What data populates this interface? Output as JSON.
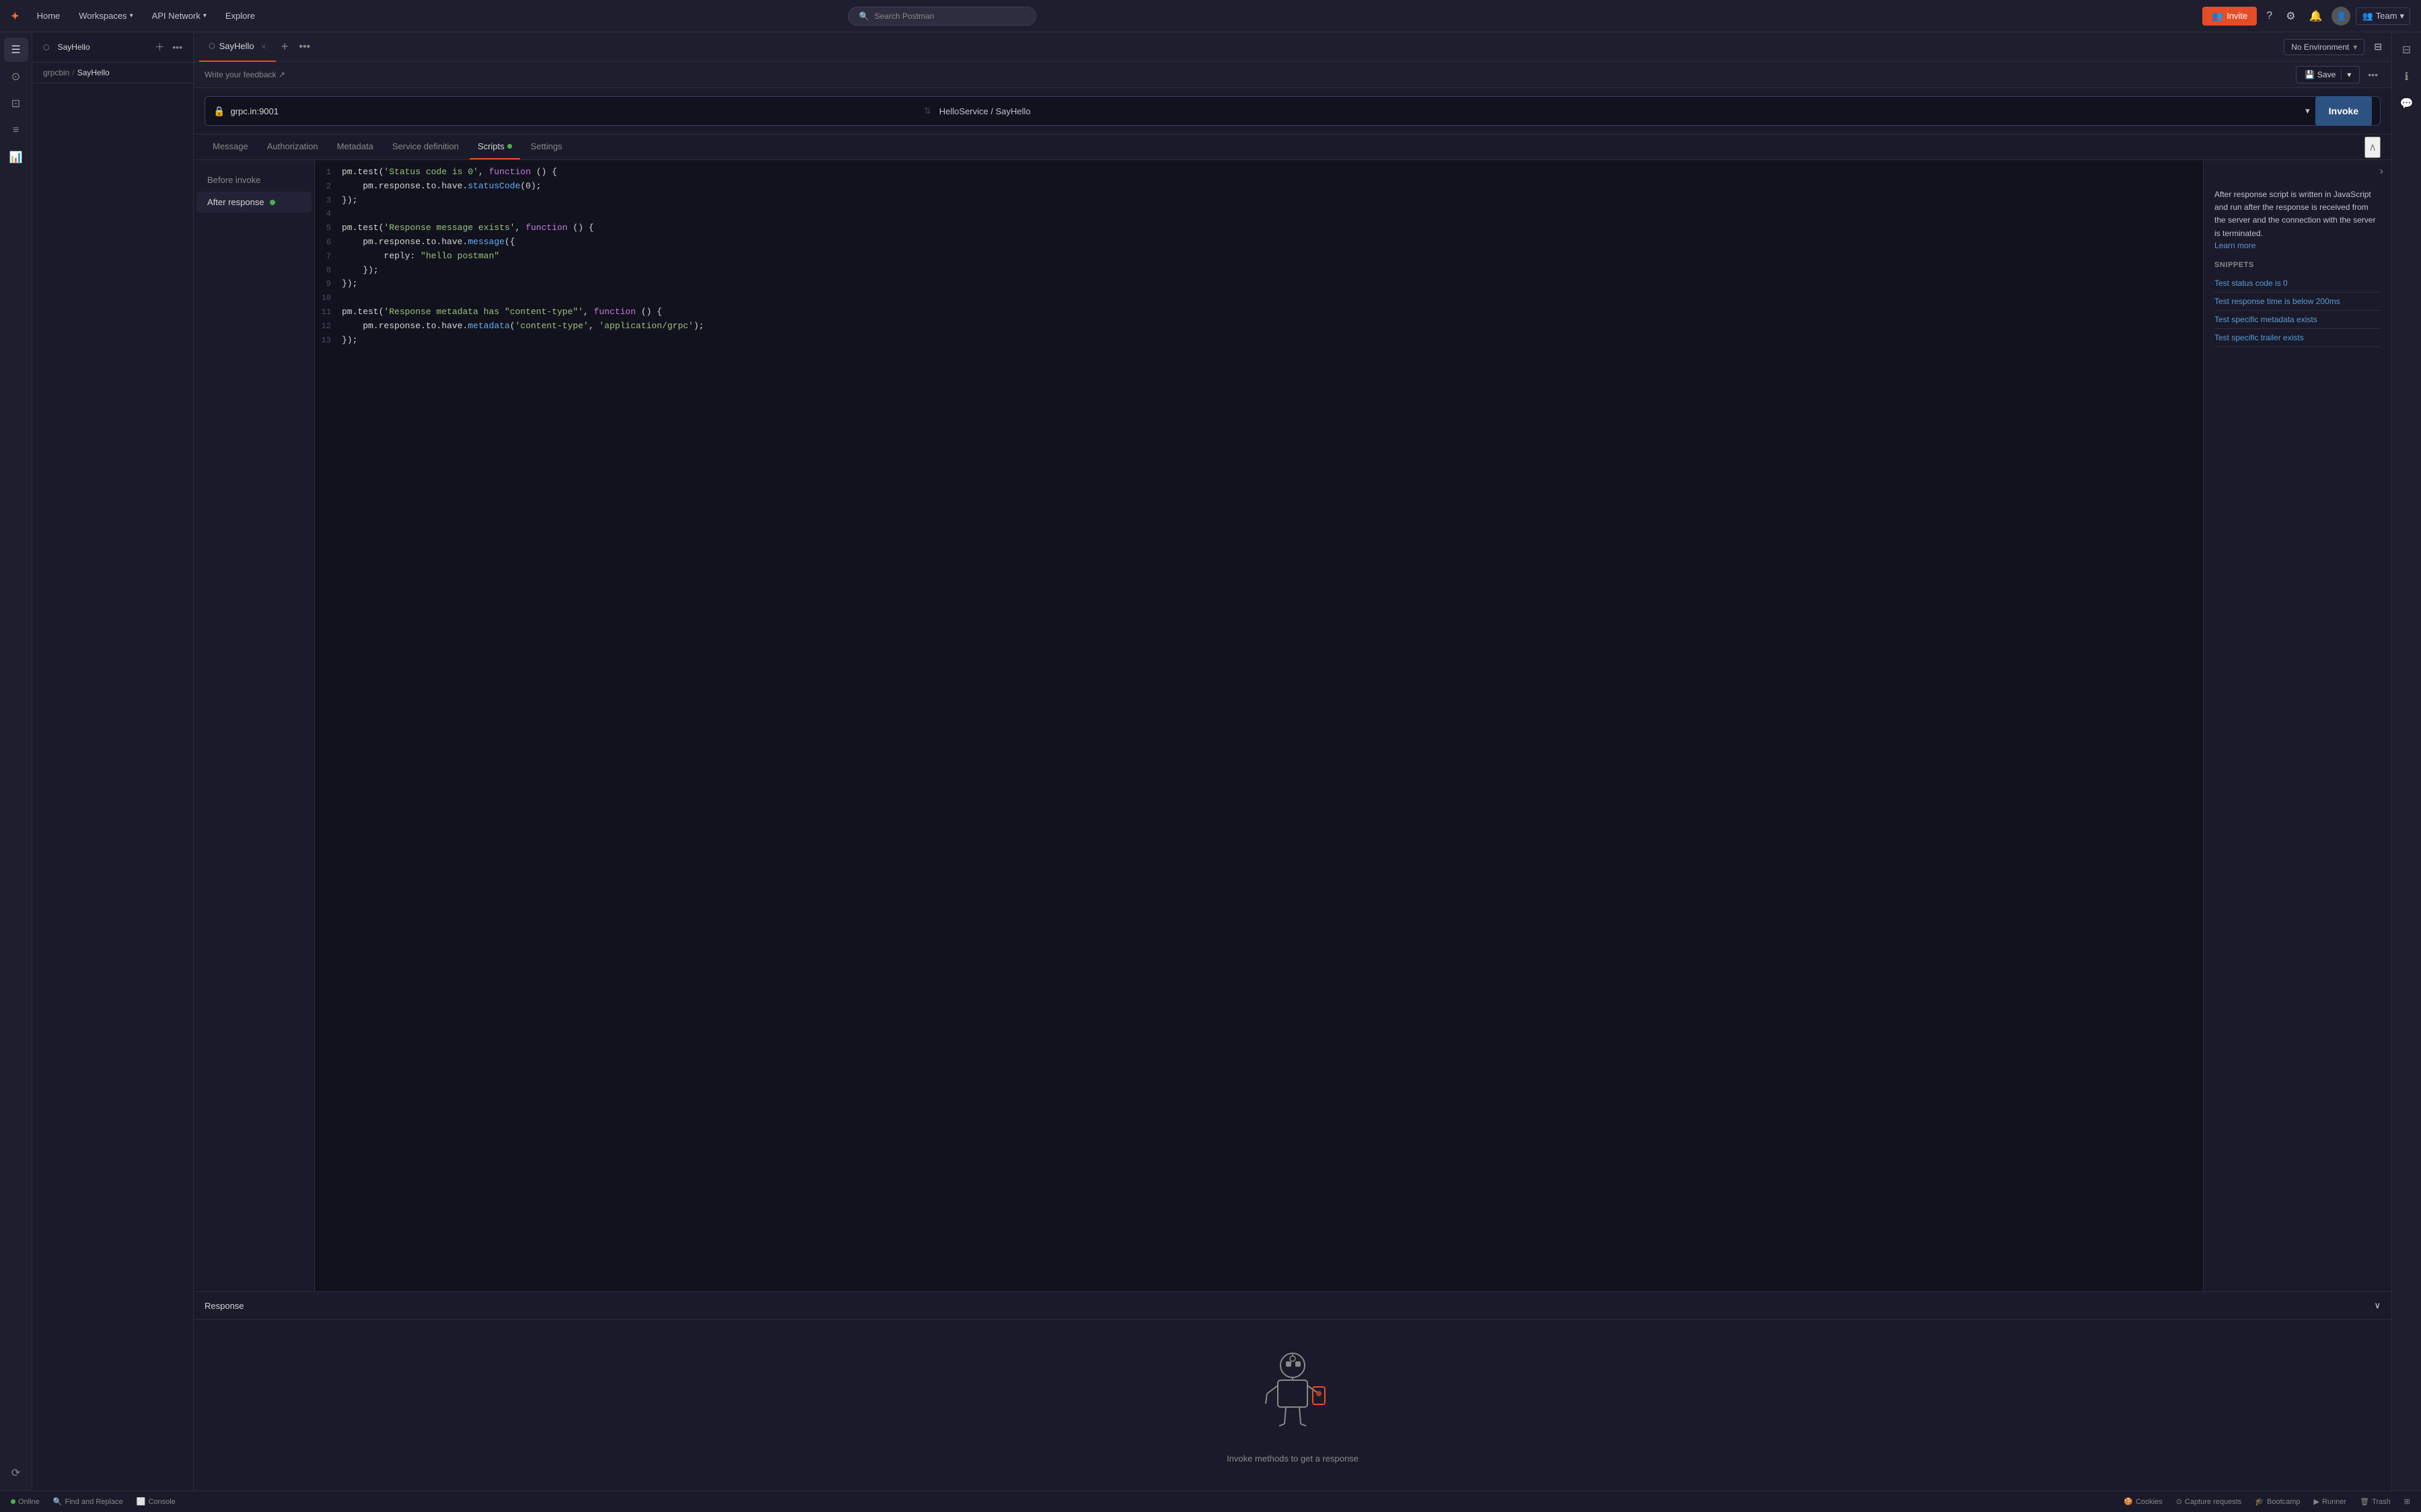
{
  "nav": {
    "home": "Home",
    "workspaces": "Workspaces",
    "api_network": "API Network",
    "explore": "Explore",
    "search_placeholder": "Search Postman",
    "invite_label": "Invite",
    "team_label": "Team"
  },
  "tabs_bar": {
    "active_tab": "SayHello",
    "tab_icon": "⬡"
  },
  "env": {
    "label": "No Environment"
  },
  "breadcrumb": {
    "parent": "grpcbin",
    "separator": "/",
    "current": "SayHello"
  },
  "request": {
    "url": "grpc.in:9001",
    "service_path": "HelloService / SayHello",
    "invoke_label": "Invoke"
  },
  "request_tabs": {
    "message": "Message",
    "authorization": "Authorization",
    "metadata": "Metadata",
    "service_definition": "Service definition",
    "scripts": "Scripts",
    "settings": "Settings"
  },
  "scripts_sidebar": {
    "before_invoke": "Before invoke",
    "after_response": "After response"
  },
  "code_lines": [
    {
      "num": 1,
      "parts": [
        {
          "text": "pm",
          "cls": "c-default"
        },
        {
          "text": ".test(",
          "cls": "c-default"
        },
        {
          "text": "'Status code is 0'",
          "cls": "c-green"
        },
        {
          "text": ", ",
          "cls": "c-default"
        },
        {
          "text": "function",
          "cls": "c-purple"
        },
        {
          "text": " () {",
          "cls": "c-default"
        }
      ]
    },
    {
      "num": 2,
      "parts": [
        {
          "text": "    pm",
          "cls": "c-default"
        },
        {
          "text": ".response.to.have.",
          "cls": "c-default"
        },
        {
          "text": "statusCode",
          "cls": "c-blue"
        },
        {
          "text": "(0);",
          "cls": "c-default"
        }
      ]
    },
    {
      "num": 3,
      "parts": [
        {
          "text": "});",
          "cls": "c-default"
        }
      ]
    },
    {
      "num": 4,
      "parts": [
        {
          "text": "",
          "cls": "c-default"
        }
      ]
    },
    {
      "num": 5,
      "parts": [
        {
          "text": "pm",
          "cls": "c-default"
        },
        {
          "text": ".test(",
          "cls": "c-default"
        },
        {
          "text": "'Response message exists'",
          "cls": "c-green"
        },
        {
          "text": ", ",
          "cls": "c-default"
        },
        {
          "text": "function",
          "cls": "c-purple"
        },
        {
          "text": " () {",
          "cls": "c-default"
        }
      ]
    },
    {
      "num": 6,
      "parts": [
        {
          "text": "    pm",
          "cls": "c-default"
        },
        {
          "text": ".response.to.have.",
          "cls": "c-default"
        },
        {
          "text": "message",
          "cls": "c-blue"
        },
        {
          "text": "({",
          "cls": "c-default"
        }
      ]
    },
    {
      "num": 7,
      "parts": [
        {
          "text": "        reply: ",
          "cls": "c-default"
        },
        {
          "text": "\"hello postman\"",
          "cls": "c-green"
        }
      ]
    },
    {
      "num": 8,
      "parts": [
        {
          "text": "    });",
          "cls": "c-default"
        }
      ]
    },
    {
      "num": 9,
      "parts": [
        {
          "text": "});",
          "cls": "c-default"
        }
      ]
    },
    {
      "num": 10,
      "parts": [
        {
          "text": "",
          "cls": "c-default"
        }
      ]
    },
    {
      "num": 11,
      "parts": [
        {
          "text": "pm",
          "cls": "c-default"
        },
        {
          "text": ".test(",
          "cls": "c-default"
        },
        {
          "text": "'Response metadata has ",
          "cls": "c-green"
        },
        {
          "text": "\"content-type\"",
          "cls": "c-green"
        },
        {
          "text": "'",
          "cls": "c-green"
        },
        {
          "text": ", ",
          "cls": "c-default"
        },
        {
          "text": "function",
          "cls": "c-purple"
        },
        {
          "text": " () {",
          "cls": "c-default"
        }
      ]
    },
    {
      "num": 12,
      "parts": [
        {
          "text": "    pm",
          "cls": "c-default"
        },
        {
          "text": ".response.to.have.",
          "cls": "c-default"
        },
        {
          "text": "metadata",
          "cls": "c-blue"
        },
        {
          "text": "(",
          "cls": "c-default"
        },
        {
          "text": "'content-type'",
          "cls": "c-green"
        },
        {
          "text": ", ",
          "cls": "c-default"
        },
        {
          "text": "'application/grpc'",
          "cls": "c-green"
        },
        {
          "text": ");",
          "cls": "c-default"
        }
      ]
    },
    {
      "num": 13,
      "parts": [
        {
          "text": "});",
          "cls": "c-default"
        }
      ]
    }
  ],
  "right_panel": {
    "description": "After response script is written in JavaScript and run after the response is received from the server and the connection with the server is terminated.",
    "learn_more": "Learn more",
    "snippets_title": "SNIPPETS",
    "snippets": [
      "Test status code is 0",
      "Test response time is below 200ms",
      "Test specific metadata exists",
      "Test specific trailer exists"
    ]
  },
  "response": {
    "title": "Response",
    "empty_message": "Invoke methods to get a response"
  },
  "status_bar": {
    "online": "Online",
    "find_replace": "Find and Replace",
    "console": "Console",
    "cookies": "Cookies",
    "capture": "Capture requests",
    "bootcamp": "Bootcamp",
    "runner": "Runner",
    "trash": "Trash"
  }
}
